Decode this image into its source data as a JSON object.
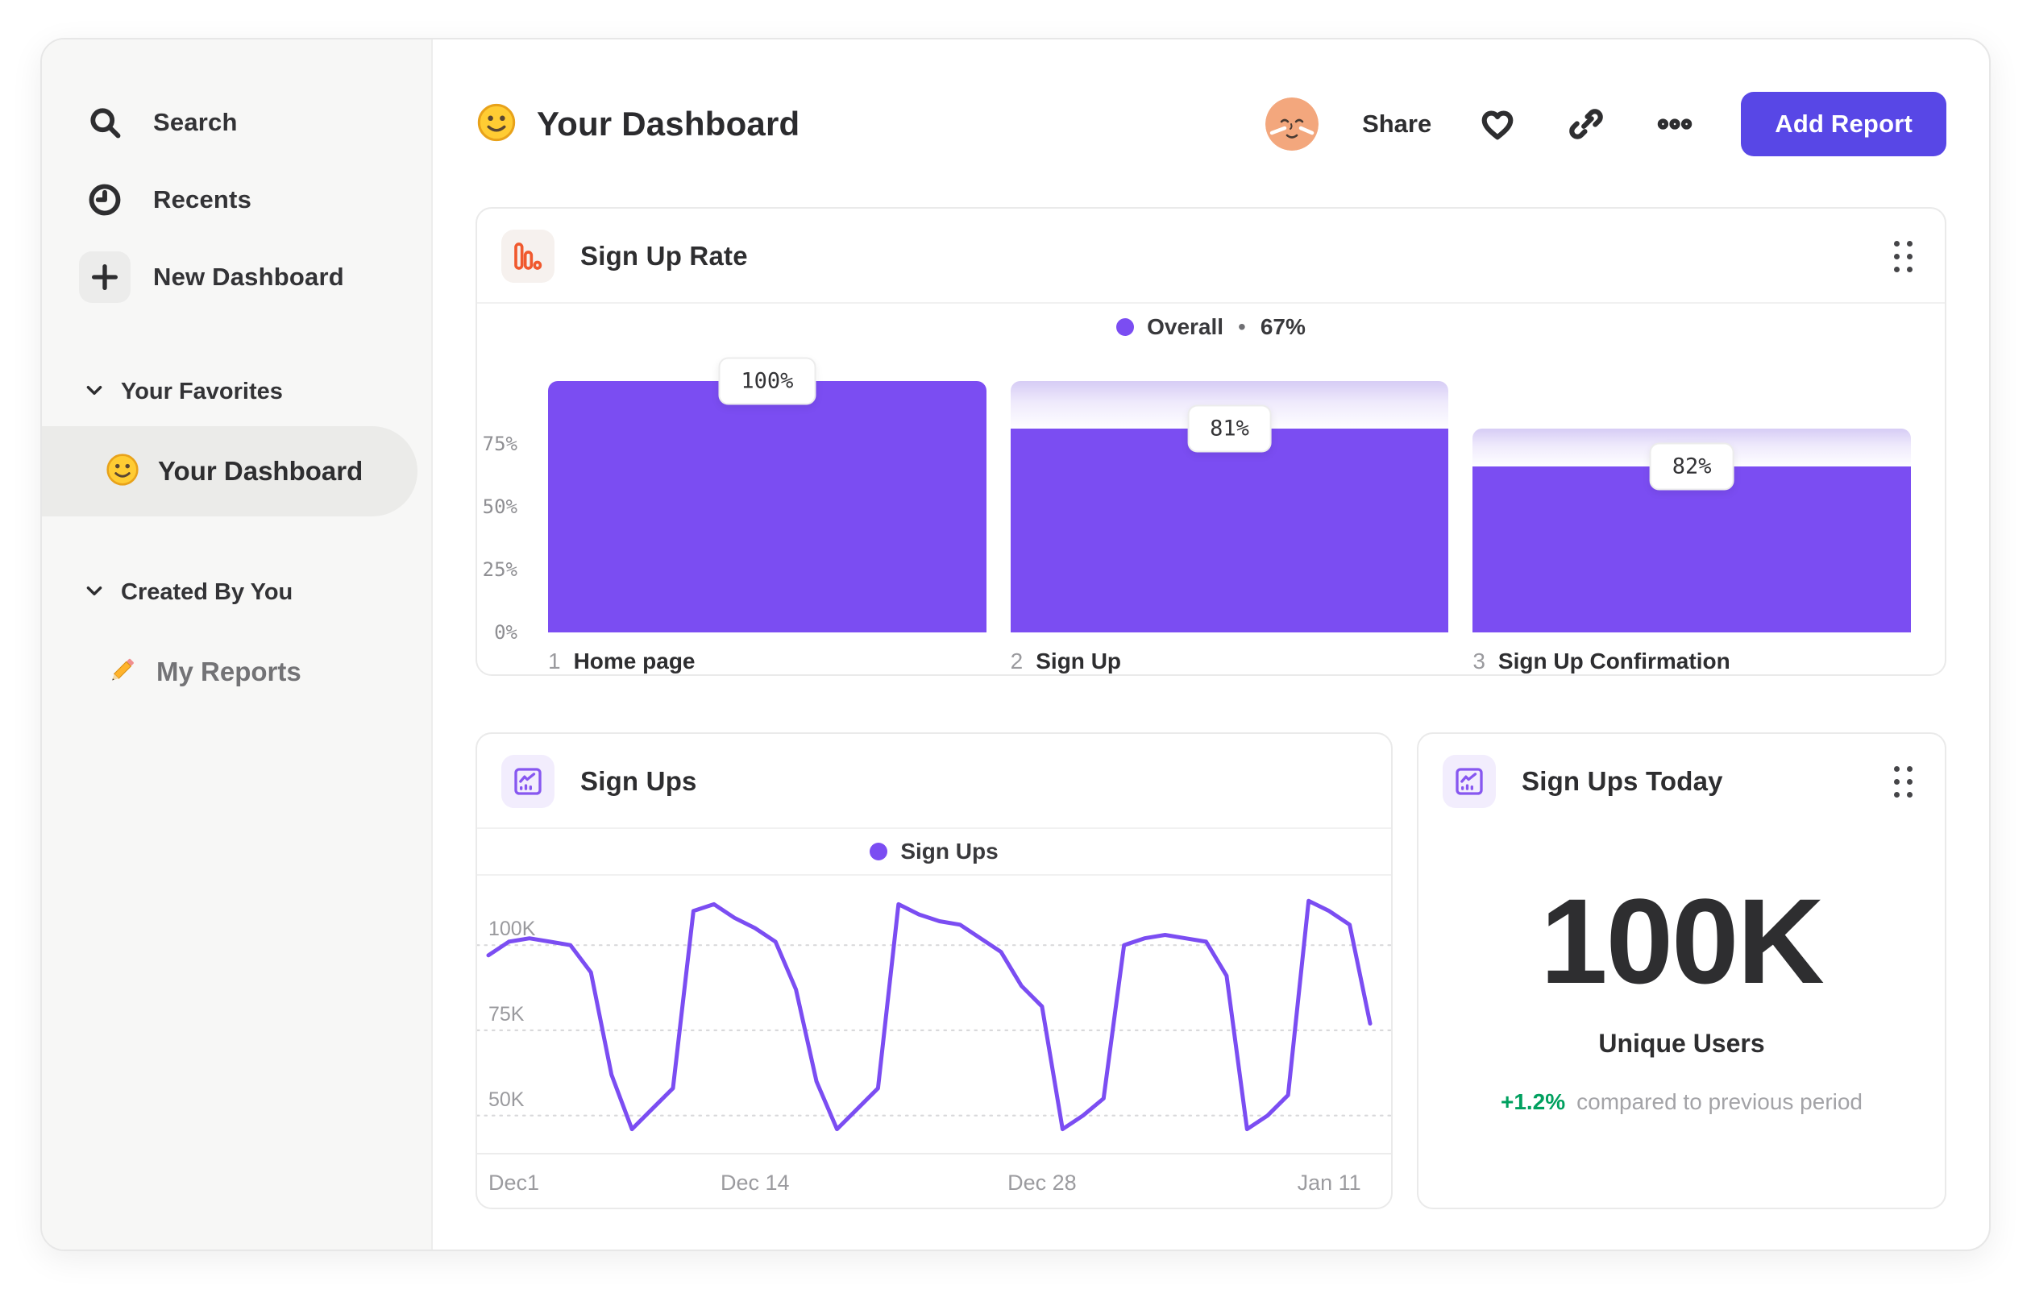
{
  "sidebar": {
    "items": [
      {
        "label": "Search"
      },
      {
        "label": "Recents"
      },
      {
        "label": "New Dashboard"
      }
    ],
    "sections": [
      {
        "title": "Your Favorites",
        "items": [
          {
            "label": "Your Dashboard",
            "selected": true,
            "icon": "smiley"
          }
        ]
      },
      {
        "title": "Created By You",
        "items": [
          {
            "label": "My Reports",
            "selected": false,
            "icon": "pencil"
          }
        ]
      }
    ]
  },
  "header": {
    "title": "Your Dashboard",
    "share_label": "Share",
    "add_report_label": "Add Report"
  },
  "cards": {
    "funnel": {
      "title": "Sign Up Rate"
    },
    "line": {
      "title": "Sign Ups"
    },
    "metric": {
      "title": "Sign Ups Today"
    }
  },
  "chart_data": [
    {
      "id": "signup-rate-funnel",
      "type": "bar",
      "subtype": "funnel",
      "title": "Sign Up Rate",
      "legend": {
        "name": "Overall",
        "sep": "•",
        "value_label": "67%",
        "color": "#7b4df2"
      },
      "ylim": [
        0,
        100
      ],
      "y_ticks": [
        {
          "label": "75%",
          "value": 75
        },
        {
          "label": "50%",
          "value": 50
        },
        {
          "label": "25%",
          "value": 25
        },
        {
          "label": "0%",
          "value": 0
        }
      ],
      "steps": [
        {
          "n": "1",
          "label": "Home page",
          "badge": "100%",
          "pct_of_top": 100,
          "pct_of_prev": 100
        },
        {
          "n": "2",
          "label": "Sign Up",
          "badge": "81%",
          "pct_of_top": 81,
          "pct_of_prev": 81
        },
        {
          "n": "3",
          "label": "Sign Up Confirmation",
          "badge": "82%",
          "pct_of_top": 66,
          "pct_of_prev": 82
        }
      ],
      "grid": false,
      "bar_color": "#7b4df2"
    },
    {
      "id": "signups-line",
      "type": "line",
      "title": "Sign Ups",
      "legend": {
        "name": "Sign Ups",
        "color": "#7b4df2",
        "position": "top-center"
      },
      "unit": "K users per day",
      "ylim_k": [
        40,
        118
      ],
      "y_ticks": [
        {
          "label": "100K",
          "value": 100
        },
        {
          "label": "75K",
          "value": 75
        },
        {
          "label": "50K",
          "value": 50
        }
      ],
      "x_ticks": [
        {
          "label": "Dec1",
          "index": 0
        },
        {
          "label": "Dec 14",
          "index": 13
        },
        {
          "label": "Dec 28",
          "index": 27
        },
        {
          "label": "Jan 11",
          "index": 41
        }
      ],
      "grid": "dotted-horizontal",
      "series": [
        {
          "name": "Sign Ups",
          "values_k": [
            97,
            101,
            102,
            101,
            100,
            92,
            62,
            46,
            52,
            58,
            110,
            112,
            108,
            105,
            101,
            87,
            60,
            46,
            52,
            58,
            112,
            109,
            107,
            106,
            102,
            98,
            88,
            82,
            46,
            50,
            55,
            100,
            102,
            103,
            102,
            101,
            91,
            46,
            50,
            56,
            113,
            110,
            106,
            77
          ]
        }
      ]
    },
    {
      "id": "signups-today-metric",
      "type": "metric",
      "title": "Sign Ups Today",
      "value": "100K",
      "label": "Unique Users",
      "delta": "+1.2%",
      "delta_color": "#00a05f",
      "comparison": "compared to previous period"
    }
  ]
}
